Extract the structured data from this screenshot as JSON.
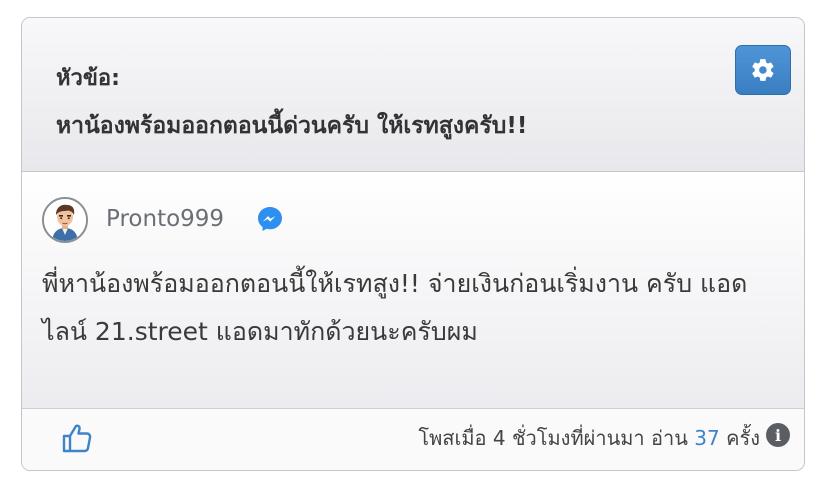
{
  "header": {
    "topic_label": "หัวข้อ:",
    "topic_title": "หาน้องพร้อมออกตอนนี้ด่วนครับ ให้เรทสูงครับ!!"
  },
  "settings": {
    "icon": "gear-icon"
  },
  "post": {
    "username": "Pronto999",
    "user_icon": "messenger-icon",
    "text": "พี่หาน้องพร้อมออกตอนนี้ให้เรทสูง!! จ่ายเงินก่อนเริ่มงาน ครับ แอดไลน์ 21.street แอดมาทักด้วยนะครับผม"
  },
  "footer": {
    "like_icon": "thumbs-up-icon",
    "posted_text": "โพสเมื่อ 4 ชั่วโมงที่ผ่านมา อ่าน",
    "view_count": "37",
    "views_suffix": "ครั้ง",
    "info_icon": "info-icon"
  },
  "colors": {
    "accent": "#3d84c8",
    "settings_button": "#4a8fd2",
    "messenger": "#2d8ff0"
  }
}
